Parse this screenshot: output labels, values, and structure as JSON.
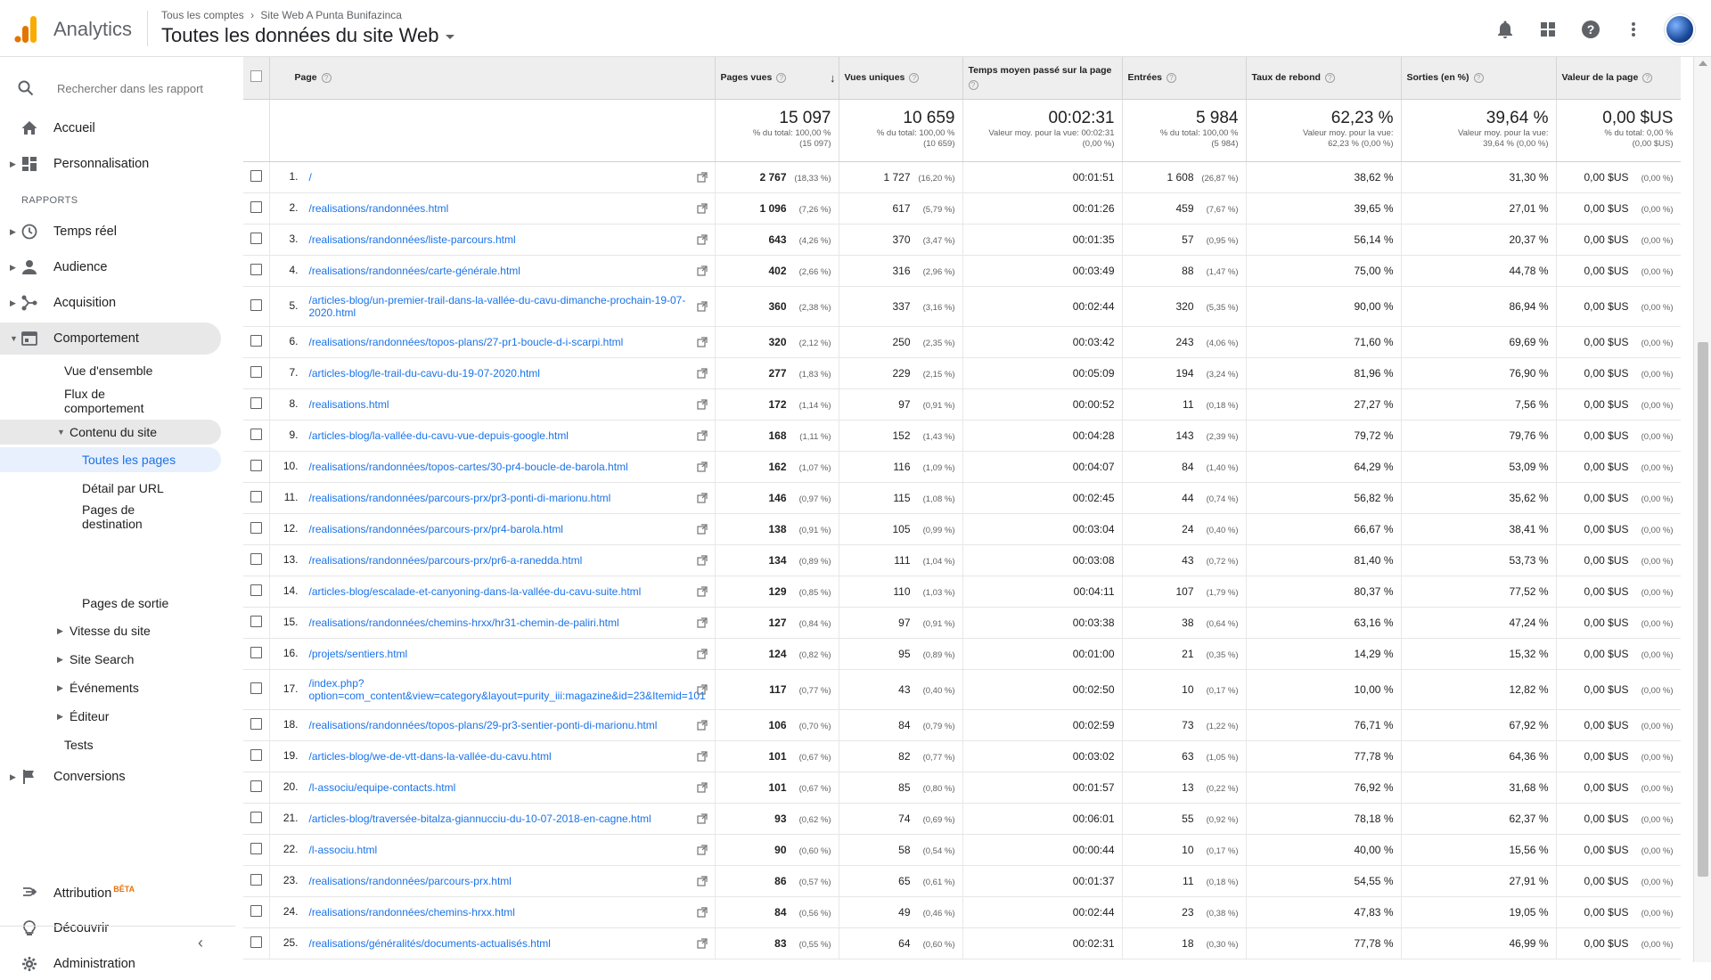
{
  "header": {
    "app_name": "Analytics",
    "breadcrumb": [
      "Tous les comptes",
      "›",
      "Site Web A Punta Bunifazinca"
    ],
    "view_title": "Toutes les données du site Web"
  },
  "sidebar": {
    "search_placeholder": "Rechercher dans les rapport",
    "accueil": "Accueil",
    "personnalisation": "Personnalisation",
    "rapports_label": "RAPPORTS",
    "temps_reel": "Temps réel",
    "audience": "Audience",
    "acquisition": "Acquisition",
    "comportement": "Comportement",
    "vue_ensemble": "Vue d'ensemble",
    "flux_comportement_1": "Flux de",
    "flux_comportement_2": "comportement",
    "contenu_site": "Contenu du site",
    "toutes_pages": "Toutes les pages",
    "detail_url": "Détail par URL",
    "pages_destination_1": "Pages de",
    "pages_destination_2": "destination",
    "pages_sortie": "Pages de sortie",
    "vitesse_site": "Vitesse du site",
    "site_search": "Site Search",
    "evenements": "Événements",
    "editeur": "Éditeur",
    "tests": "Tests",
    "conversions": "Conversions",
    "attribution": "Attribution",
    "attribution_badge": "BÊTA",
    "decouvrir": "Découvrir",
    "administration": "Administration"
  },
  "table": {
    "headers": {
      "page": "Page",
      "pages_vues": "Pages vues",
      "vues_uniques": "Vues uniques",
      "temps_moyen": "Temps moyen passé sur la page",
      "entrees": "Entrées",
      "taux_rebond": "Taux de rebond",
      "sorties": "Sorties (en %)",
      "valeur": "Valeur de la page"
    },
    "totals": {
      "pages_vues": {
        "v": "15 097",
        "s1": "% du total: 100,00 %",
        "s2": "(15 097)"
      },
      "vues_uniques": {
        "v": "10 659",
        "s1": "% du total: 100,00 %",
        "s2": "(10 659)"
      },
      "temps_moyen": {
        "v": "00:02:31",
        "s1": "Valeur moy. pour la vue: 00:02:31",
        "s2": "(0,00 %)"
      },
      "entrees": {
        "v": "5 984",
        "s1": "% du total: 100,00 %",
        "s2": "(5 984)"
      },
      "taux_rebond": {
        "v": "62,23 %",
        "s1": "Valeur moy. pour la vue:",
        "s2": "62,23 % (0,00 %)"
      },
      "sorties": {
        "v": "39,64 %",
        "s1": "Valeur moy. pour la vue:",
        "s2": "39,64 % (0,00 %)"
      },
      "valeur": {
        "v": "0,00 $US",
        "s1": "% du total: 0,00 %",
        "s2": "(0,00 $US)"
      }
    },
    "rows": [
      {
        "n": "1.",
        "page": "/",
        "pv": "2 767",
        "pvp": "(18,33 %)",
        "vu": "1 727",
        "vup": "(16,20 %)",
        "t": "00:01:51",
        "e": "1 608",
        "ep": "(26,87 %)",
        "tr": "38,62 %",
        "s": "31,30 %",
        "val": "0,00 $US",
        "valp": "(0,00 %)"
      },
      {
        "n": "2.",
        "page": "/realisations/randonnées.html",
        "pv": "1 096",
        "pvp": "(7,26 %)",
        "vu": "617",
        "vup": "(5,79 %)",
        "t": "00:01:26",
        "e": "459",
        "ep": "(7,67 %)",
        "tr": "39,65 %",
        "s": "27,01 %",
        "val": "0,00 $US",
        "valp": "(0,00 %)"
      },
      {
        "n": "3.",
        "page": "/realisations/randonnées/liste-parcours.html",
        "pv": "643",
        "pvp": "(4,26 %)",
        "vu": "370",
        "vup": "(3,47 %)",
        "t": "00:01:35",
        "e": "57",
        "ep": "(0,95 %)",
        "tr": "56,14 %",
        "s": "20,37 %",
        "val": "0,00 $US",
        "valp": "(0,00 %)"
      },
      {
        "n": "4.",
        "page": "/realisations/randonnées/carte-générale.html",
        "pv": "402",
        "pvp": "(2,66 %)",
        "vu": "316",
        "vup": "(2,96 %)",
        "t": "00:03:49",
        "e": "88",
        "ep": "(1,47 %)",
        "tr": "75,00 %",
        "s": "44,78 %",
        "val": "0,00 $US",
        "valp": "(0,00 %)"
      },
      {
        "n": "5.",
        "page": "/articles-blog/un-premier-trail-dans-la-vallée-du-cavu-dimanche-prochain-19-07-2020.html",
        "pv": "360",
        "pvp": "(2,38 %)",
        "vu": "337",
        "vup": "(3,16 %)",
        "t": "00:02:44",
        "e": "320",
        "ep": "(5,35 %)",
        "tr": "90,00 %",
        "s": "86,94 %",
        "val": "0,00 $US",
        "valp": "(0,00 %)",
        "tall": true
      },
      {
        "n": "6.",
        "page": "/realisations/randonnées/topos-plans/27-pr1-boucle-d-i-scarpi.html",
        "pv": "320",
        "pvp": "(2,12 %)",
        "vu": "250",
        "vup": "(2,35 %)",
        "t": "00:03:42",
        "e": "243",
        "ep": "(4,06 %)",
        "tr": "71,60 %",
        "s": "69,69 %",
        "val": "0,00 $US",
        "valp": "(0,00 %)"
      },
      {
        "n": "7.",
        "page": "/articles-blog/le-trail-du-cavu-du-19-07-2020.html",
        "pv": "277",
        "pvp": "(1,83 %)",
        "vu": "229",
        "vup": "(2,15 %)",
        "t": "00:05:09",
        "e": "194",
        "ep": "(3,24 %)",
        "tr": "81,96 %",
        "s": "76,90 %",
        "val": "0,00 $US",
        "valp": "(0,00 %)"
      },
      {
        "n": "8.",
        "page": "/realisations.html",
        "pv": "172",
        "pvp": "(1,14 %)",
        "vu": "97",
        "vup": "(0,91 %)",
        "t": "00:00:52",
        "e": "11",
        "ep": "(0,18 %)",
        "tr": "27,27 %",
        "s": "7,56 %",
        "val": "0,00 $US",
        "valp": "(0,00 %)"
      },
      {
        "n": "9.",
        "page": "/articles-blog/la-vallée-du-cavu-vue-depuis-google.html",
        "pv": "168",
        "pvp": "(1,11 %)",
        "vu": "152",
        "vup": "(1,43 %)",
        "t": "00:04:28",
        "e": "143",
        "ep": "(2,39 %)",
        "tr": "79,72 %",
        "s": "79,76 %",
        "val": "0,00 $US",
        "valp": "(0,00 %)"
      },
      {
        "n": "10.",
        "page": "/realisations/randonnées/topos-cartes/30-pr4-boucle-de-barola.html",
        "pv": "162",
        "pvp": "(1,07 %)",
        "vu": "116",
        "vup": "(1,09 %)",
        "t": "00:04:07",
        "e": "84",
        "ep": "(1,40 %)",
        "tr": "64,29 %",
        "s": "53,09 %",
        "val": "0,00 $US",
        "valp": "(0,00 %)"
      },
      {
        "n": "11.",
        "page": "/realisations/randonnées/parcours-prx/pr3-ponti-di-marionu.html",
        "pv": "146",
        "pvp": "(0,97 %)",
        "vu": "115",
        "vup": "(1,08 %)",
        "t": "00:02:45",
        "e": "44",
        "ep": "(0,74 %)",
        "tr": "56,82 %",
        "s": "35,62 %",
        "val": "0,00 $US",
        "valp": "(0,00 %)"
      },
      {
        "n": "12.",
        "page": "/realisations/randonnées/parcours-prx/pr4-barola.html",
        "pv": "138",
        "pvp": "(0,91 %)",
        "vu": "105",
        "vup": "(0,99 %)",
        "t": "00:03:04",
        "e": "24",
        "ep": "(0,40 %)",
        "tr": "66,67 %",
        "s": "38,41 %",
        "val": "0,00 $US",
        "valp": "(0,00 %)"
      },
      {
        "n": "13.",
        "page": "/realisations/randonnées/parcours-prx/pr6-a-ranedda.html",
        "pv": "134",
        "pvp": "(0,89 %)",
        "vu": "111",
        "vup": "(1,04 %)",
        "t": "00:03:08",
        "e": "43",
        "ep": "(0,72 %)",
        "tr": "81,40 %",
        "s": "53,73 %",
        "val": "0,00 $US",
        "valp": "(0,00 %)"
      },
      {
        "n": "14.",
        "page": "/articles-blog/escalade-et-canyoning-dans-la-vallée-du-cavu-suite.html",
        "pv": "129",
        "pvp": "(0,85 %)",
        "vu": "110",
        "vup": "(1,03 %)",
        "t": "00:04:11",
        "e": "107",
        "ep": "(1,79 %)",
        "tr": "80,37 %",
        "s": "77,52 %",
        "val": "0,00 $US",
        "valp": "(0,00 %)"
      },
      {
        "n": "15.",
        "page": "/realisations/randonnées/chemins-hrxx/hr31-chemin-de-paliri.html",
        "pv": "127",
        "pvp": "(0,84 %)",
        "vu": "97",
        "vup": "(0,91 %)",
        "t": "00:03:38",
        "e": "38",
        "ep": "(0,64 %)",
        "tr": "63,16 %",
        "s": "47,24 %",
        "val": "0,00 $US",
        "valp": "(0,00 %)"
      },
      {
        "n": "16.",
        "page": "/projets/sentiers.html",
        "pv": "124",
        "pvp": "(0,82 %)",
        "vu": "95",
        "vup": "(0,89 %)",
        "t": "00:01:00",
        "e": "21",
        "ep": "(0,35 %)",
        "tr": "14,29 %",
        "s": "15,32 %",
        "val": "0,00 $US",
        "valp": "(0,00 %)"
      },
      {
        "n": "17.",
        "page": "/index.php?option=com_content&view=category&layout=purity_iii:magazine&id=23&Itemid=101",
        "pv": "117",
        "pvp": "(0,77 %)",
        "vu": "43",
        "vup": "(0,40 %)",
        "t": "00:02:50",
        "e": "10",
        "ep": "(0,17 %)",
        "tr": "10,00 %",
        "s": "12,82 %",
        "val": "0,00 $US",
        "valp": "(0,00 %)",
        "tall": true
      },
      {
        "n": "18.",
        "page": "/realisations/randonnées/topos-plans/29-pr3-sentier-ponti-di-marionu.html",
        "pv": "106",
        "pvp": "(0,70 %)",
        "vu": "84",
        "vup": "(0,79 %)",
        "t": "00:02:59",
        "e": "73",
        "ep": "(1,22 %)",
        "tr": "76,71 %",
        "s": "67,92 %",
        "val": "0,00 $US",
        "valp": "(0,00 %)"
      },
      {
        "n": "19.",
        "page": "/articles-blog/we-de-vtt-dans-la-vallée-du-cavu.html",
        "pv": "101",
        "pvp": "(0,67 %)",
        "vu": "82",
        "vup": "(0,77 %)",
        "t": "00:03:02",
        "e": "63",
        "ep": "(1,05 %)",
        "tr": "77,78 %",
        "s": "64,36 %",
        "val": "0,00 $US",
        "valp": "(0,00 %)"
      },
      {
        "n": "20.",
        "page": "/l-associu/equipe-contacts.html",
        "pv": "101",
        "pvp": "(0,67 %)",
        "vu": "85",
        "vup": "(0,80 %)",
        "t": "00:01:57",
        "e": "13",
        "ep": "(0,22 %)",
        "tr": "76,92 %",
        "s": "31,68 %",
        "val": "0,00 $US",
        "valp": "(0,00 %)"
      },
      {
        "n": "21.",
        "page": "/articles-blog/traversée-bitalza-giannucciu-du-10-07-2018-en-cagne.html",
        "pv": "93",
        "pvp": "(0,62 %)",
        "vu": "74",
        "vup": "(0,69 %)",
        "t": "00:06:01",
        "e": "55",
        "ep": "(0,92 %)",
        "tr": "78,18 %",
        "s": "62,37 %",
        "val": "0,00 $US",
        "valp": "(0,00 %)"
      },
      {
        "n": "22.",
        "page": "/l-associu.html",
        "pv": "90",
        "pvp": "(0,60 %)",
        "vu": "58",
        "vup": "(0,54 %)",
        "t": "00:00:44",
        "e": "10",
        "ep": "(0,17 %)",
        "tr": "40,00 %",
        "s": "15,56 %",
        "val": "0,00 $US",
        "valp": "(0,00 %)"
      },
      {
        "n": "23.",
        "page": "/realisations/randonnées/parcours-prx.html",
        "pv": "86",
        "pvp": "(0,57 %)",
        "vu": "65",
        "vup": "(0,61 %)",
        "t": "00:01:37",
        "e": "11",
        "ep": "(0,18 %)",
        "tr": "54,55 %",
        "s": "27,91 %",
        "val": "0,00 $US",
        "valp": "(0,00 %)"
      },
      {
        "n": "24.",
        "page": "/realisations/randonnées/chemins-hrxx.html",
        "pv": "84",
        "pvp": "(0,56 %)",
        "vu": "49",
        "vup": "(0,46 %)",
        "t": "00:02:44",
        "e": "23",
        "ep": "(0,38 %)",
        "tr": "47,83 %",
        "s": "19,05 %",
        "val": "0,00 $US",
        "valp": "(0,00 %)"
      },
      {
        "n": "25.",
        "page": "/realisations/généralités/documents-actualisés.html",
        "pv": "83",
        "pvp": "(0,55 %)",
        "vu": "64",
        "vup": "(0,60 %)",
        "t": "00:02:31",
        "e": "18",
        "ep": "(0,30 %)",
        "tr": "77,78 %",
        "s": "46,99 %",
        "val": "0,00 $US",
        "valp": "(0,00 %)"
      }
    ]
  },
  "colors": {
    "accent": "#1a73e8",
    "logo_orange": "#f9ab00",
    "logo_dark": "#e37400"
  }
}
